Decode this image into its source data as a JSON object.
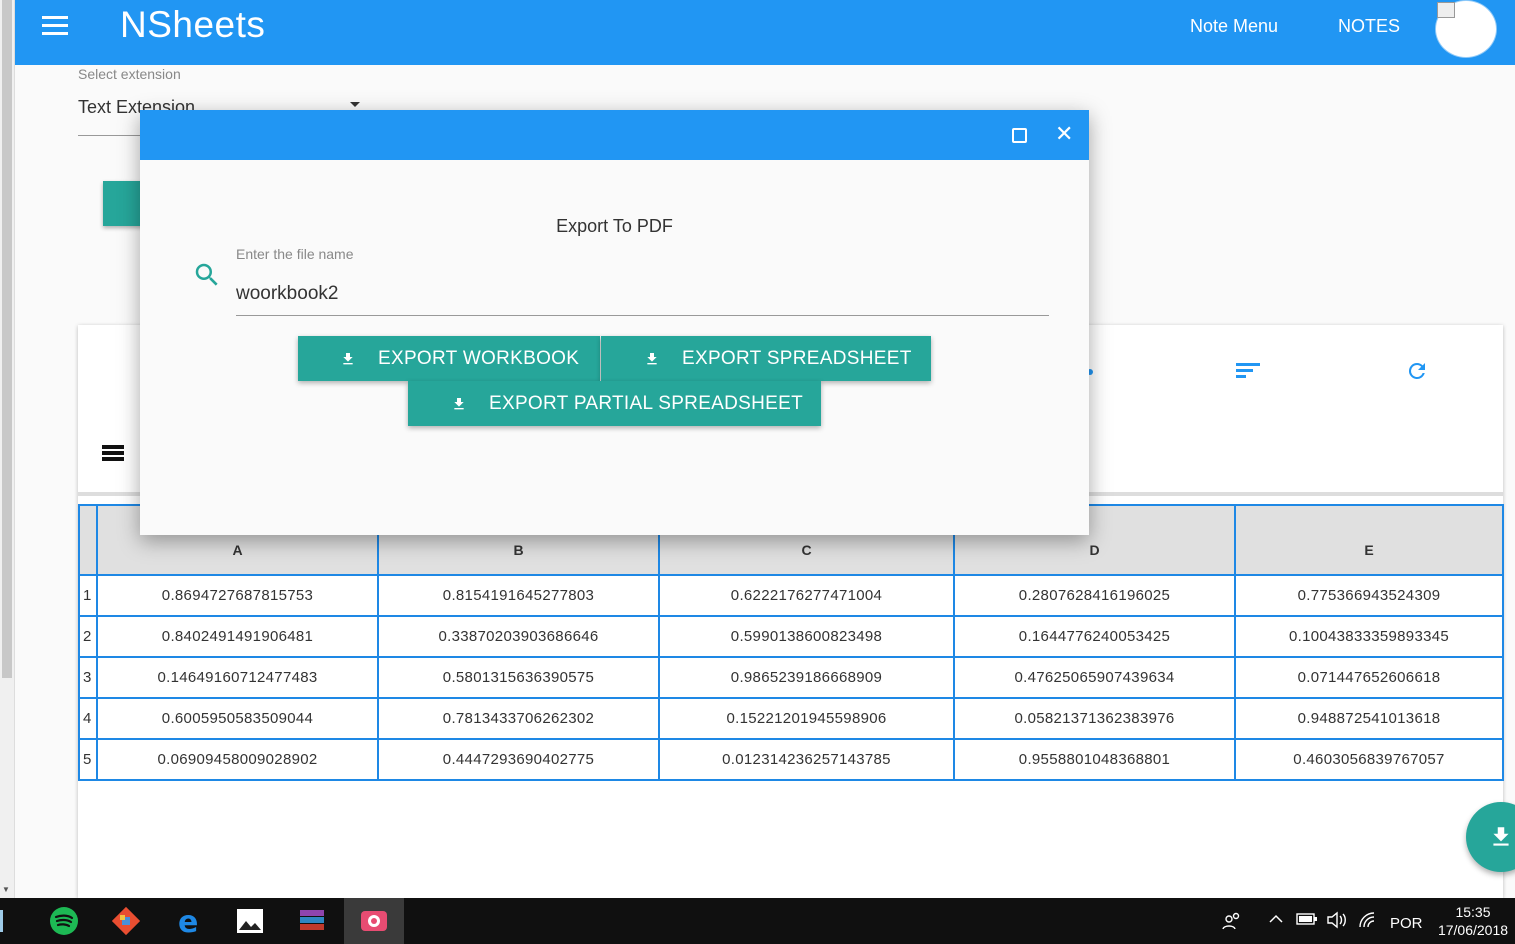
{
  "appbar": {
    "brand": "NSheets",
    "nav_menu": "Note Menu",
    "nav_notes": "NOTES",
    "color": "#2196f3"
  },
  "extension": {
    "label": "Select extension",
    "value": "Text Extension"
  },
  "modal": {
    "title": "Export To PDF",
    "field_label": "Enter the file name",
    "field_value": "woorkbook2",
    "buttons": {
      "workbook": "EXPORT WORKBOOK",
      "spreadsheet": "EXPORT SPREADSHEET",
      "partial": "EXPORT PARTIAL SPREADSHEET"
    },
    "accent": "#26a69a"
  },
  "sheet": {
    "columns": [
      "A",
      "B",
      "C",
      "D",
      "E"
    ],
    "rows": [
      {
        "num": "1",
        "cells": [
          "0.8694727687815753",
          "0.8154191645277803",
          "0.6222176277471004",
          "0.2807628416196025",
          "0.775366943524309"
        ]
      },
      {
        "num": "2",
        "cells": [
          "0.8402491491906481",
          "0.33870203903686646",
          "0.5990138600823498",
          "0.1644776240053425",
          "0.10043833359893345"
        ]
      },
      {
        "num": "3",
        "cells": [
          "0.14649160712477483",
          "0.5801315636390575",
          "0.9865239186668909",
          "0.47625065907439634",
          "0.071447652606618"
        ]
      },
      {
        "num": "4",
        "cells": [
          "0.6005950583509044",
          "0.7813433706262302",
          "0.15221201945598906",
          "0.05821371362383976",
          "0.948872541013618"
        ]
      },
      {
        "num": "5",
        "cells": [
          "0.06909458009028902",
          "0.4447293690402775",
          "0.012314236257143785",
          "0.9558801048368801",
          "0.4603056839767057"
        ]
      }
    ]
  },
  "taskbar": {
    "apps": [
      "spotify-icon",
      "git-icon",
      "edge-icon",
      "photos-icon",
      "winrar-icon",
      "camera-icon"
    ],
    "language": "POR",
    "time": "15:35",
    "date": "17/06/2018"
  }
}
